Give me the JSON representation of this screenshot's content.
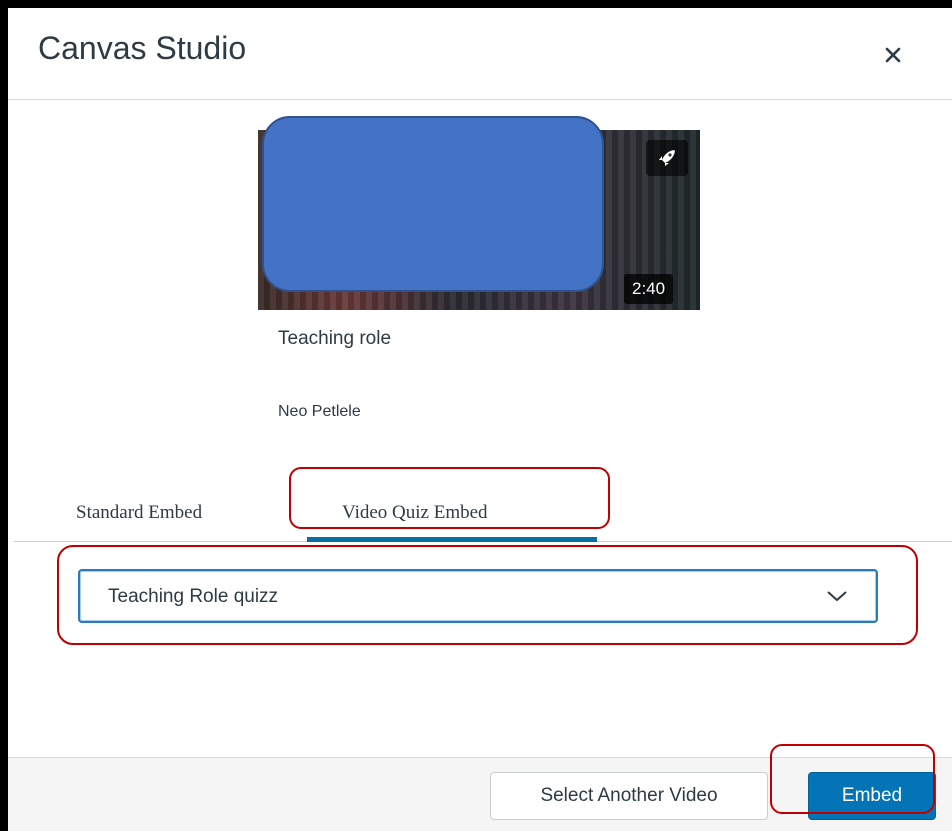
{
  "dialog": {
    "title": "Canvas Studio",
    "close_icon": "close-icon"
  },
  "video": {
    "duration": "2:40",
    "title": "Teaching role",
    "author": "Neo Petlele",
    "badge_icon": "rocket-icon"
  },
  "tabs": [
    {
      "label": "Standard Embed",
      "active": false
    },
    {
      "label": "Video Quiz Embed",
      "active": true
    }
  ],
  "quiz_select": {
    "value": "Teaching Role quizz",
    "icon": "chevron-down-icon"
  },
  "footer": {
    "secondary_label": "Select Another Video",
    "primary_label": "Embed"
  },
  "colors": {
    "primary": "#0374b5",
    "tab_active": "#0770a3",
    "highlight": "#c00000",
    "redaction": "#4472c4"
  }
}
